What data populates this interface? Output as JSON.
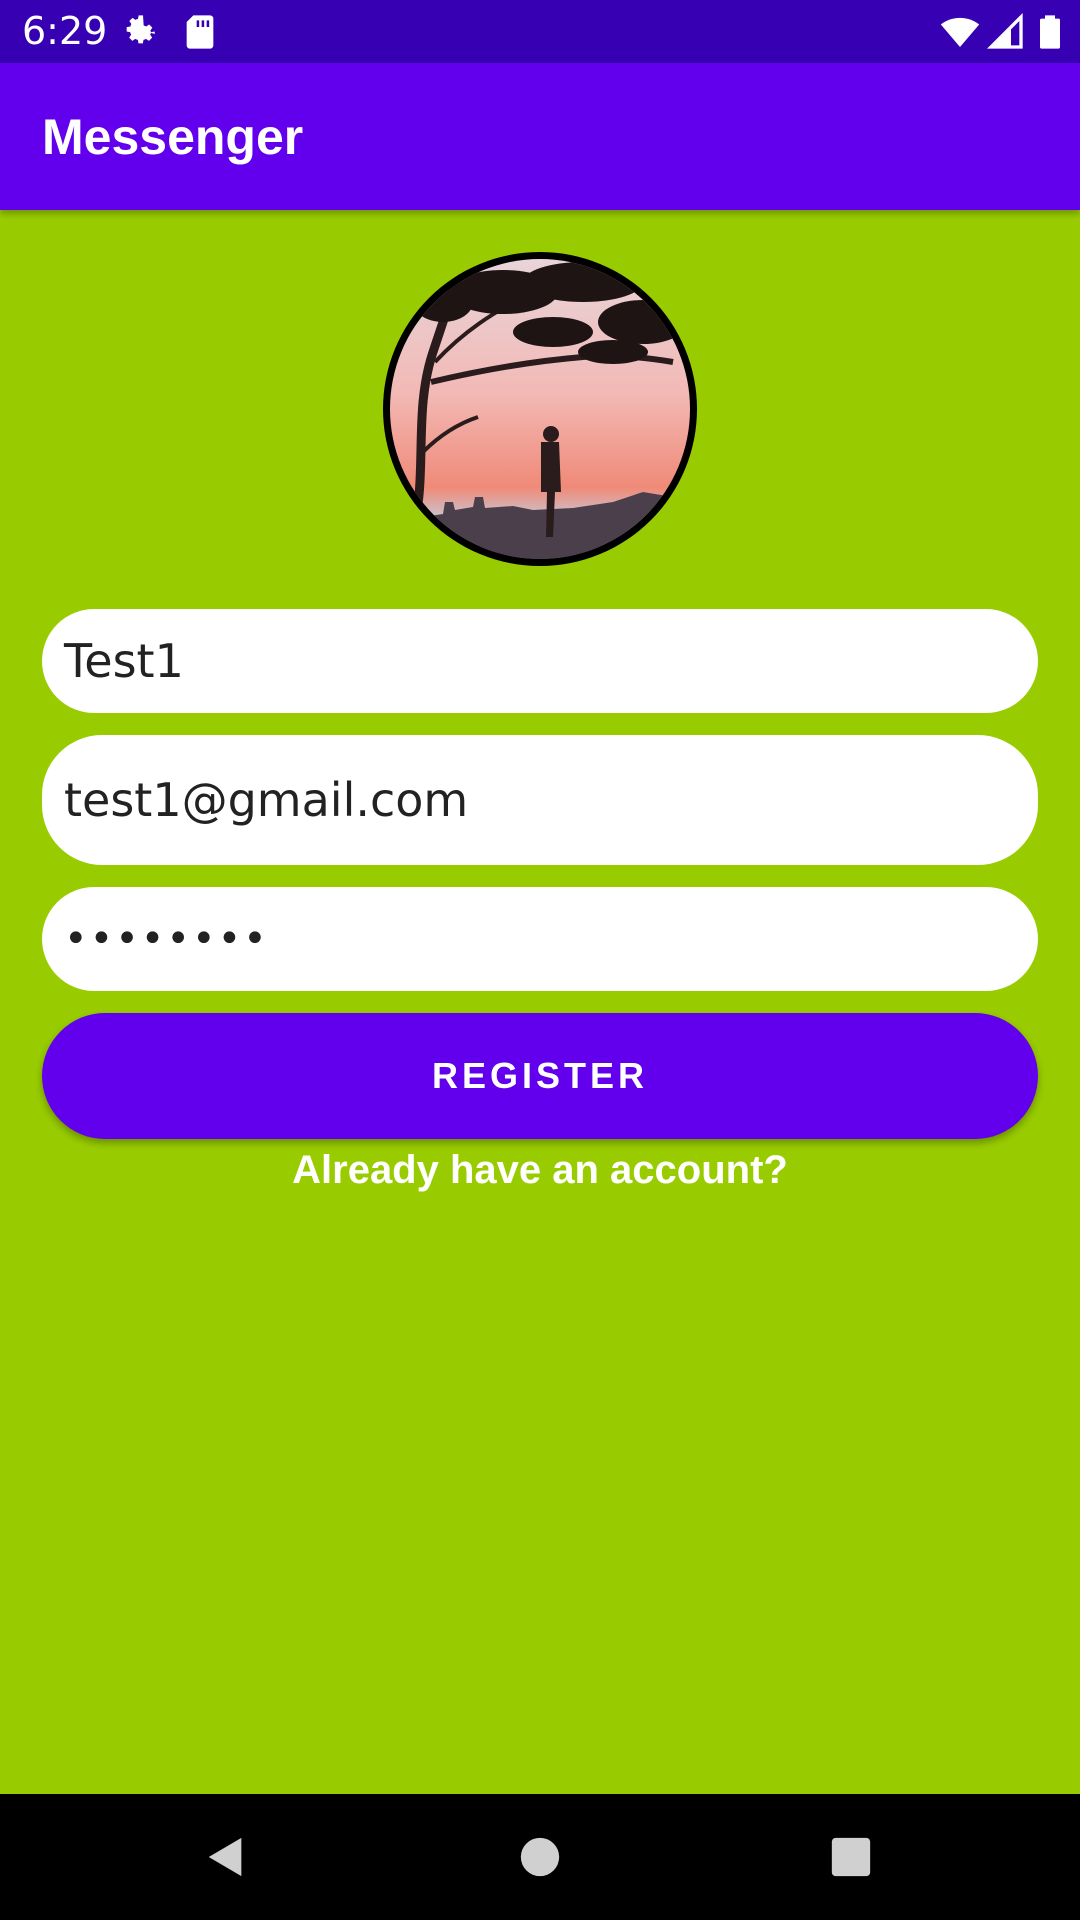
{
  "status_bar": {
    "time": "6:29",
    "icons": [
      "gear-icon",
      "sd-card-icon",
      "wifi-icon",
      "signal-icon",
      "battery-icon"
    ]
  },
  "app_bar": {
    "title": "Messenger"
  },
  "avatar": {
    "icon": "profile-photo"
  },
  "form": {
    "username_value": "Test1",
    "email_value": "test1@gmail.com",
    "password_value": "••••••••",
    "register_label": "REGISTER",
    "login_link": "Already have an account?"
  },
  "nav_bar": {
    "icons": [
      "back-icon",
      "home-icon",
      "recents-icon"
    ]
  },
  "colors": {
    "status_bar": "#3700b3",
    "app_bar": "#6200ee",
    "background": "#99cc00",
    "button": "#6200ee"
  }
}
